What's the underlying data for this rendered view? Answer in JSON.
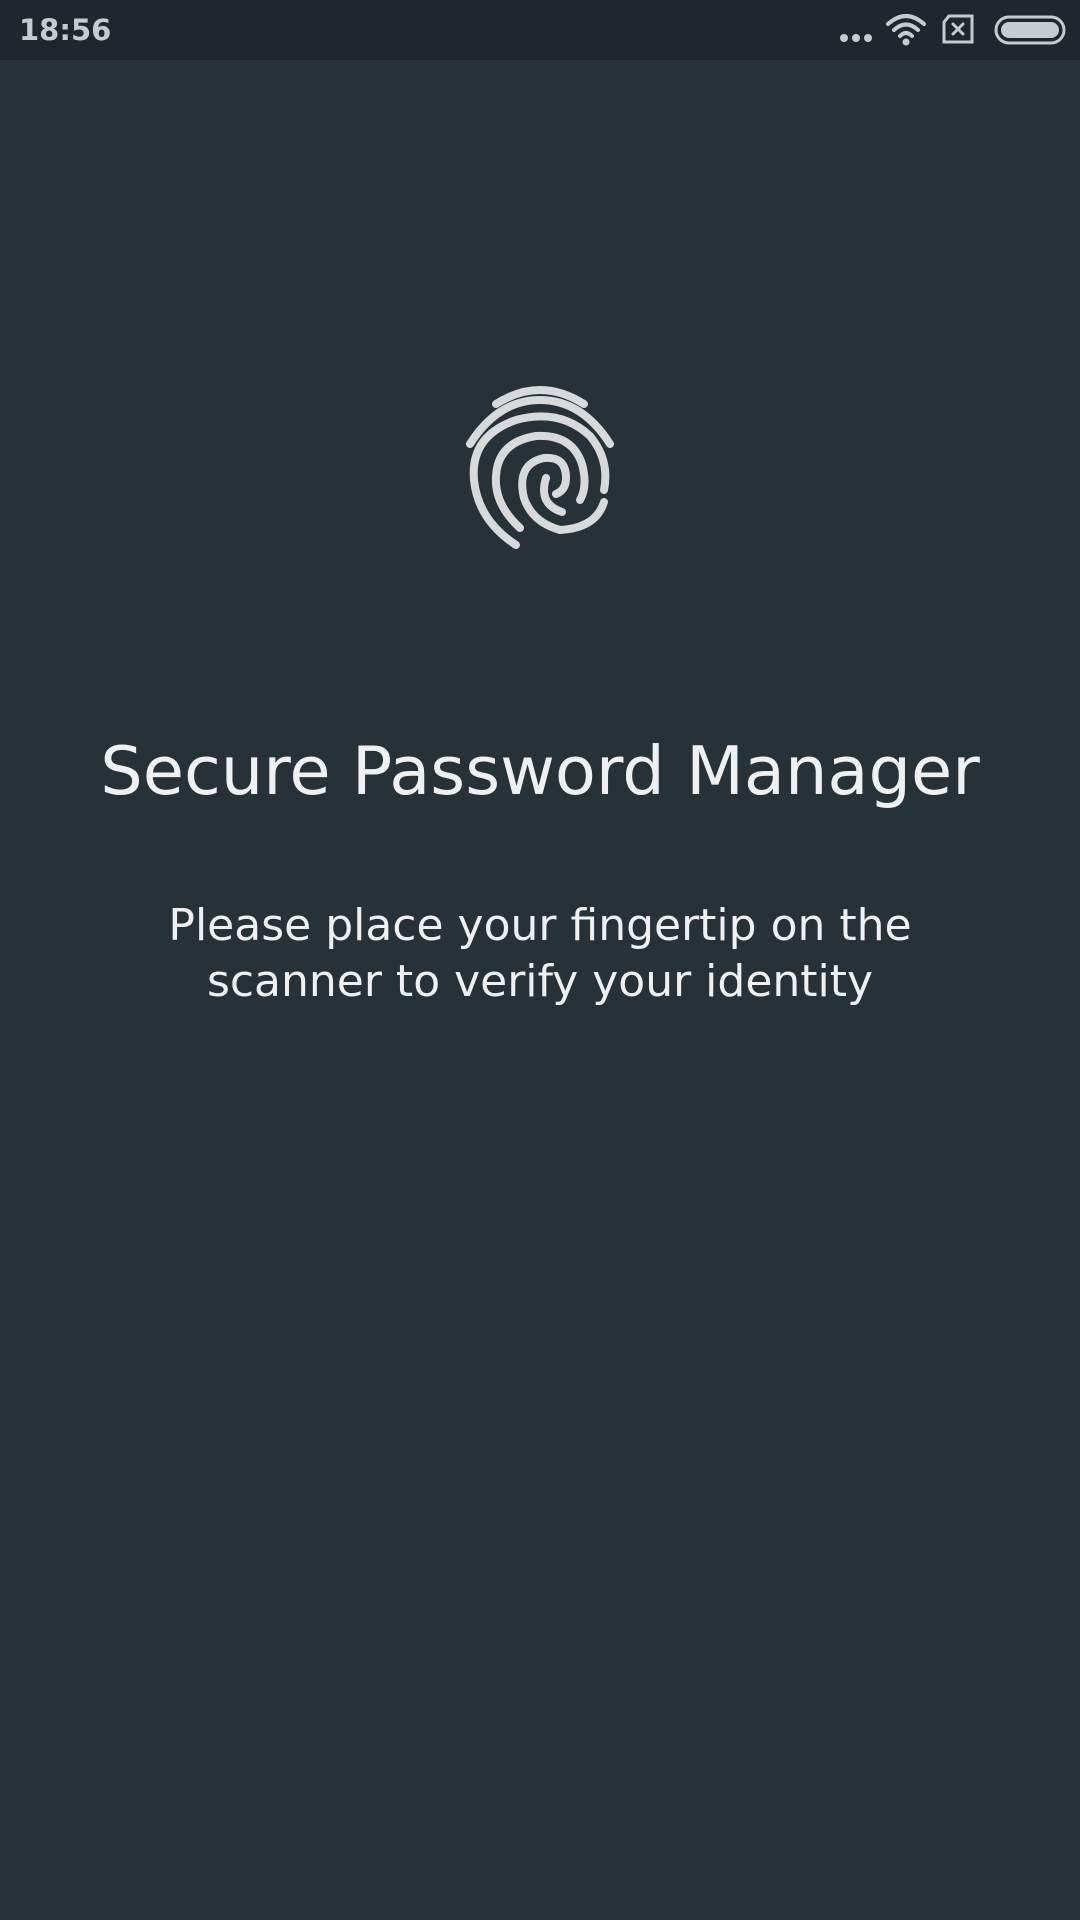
{
  "status_bar": {
    "time": "18:56",
    "icons": [
      "more-dots-icon",
      "wifi-icon",
      "no-sim-icon",
      "battery-icon"
    ]
  },
  "main": {
    "icon": "fingerprint-icon",
    "title": "Secure Password Manager",
    "instruction": "Please place your fingertip on the scanner to verify your identity"
  },
  "colors": {
    "background": "#263238",
    "status_bar": "#1f272d",
    "text": "#eef0f1",
    "icon": "#d7d9da"
  }
}
